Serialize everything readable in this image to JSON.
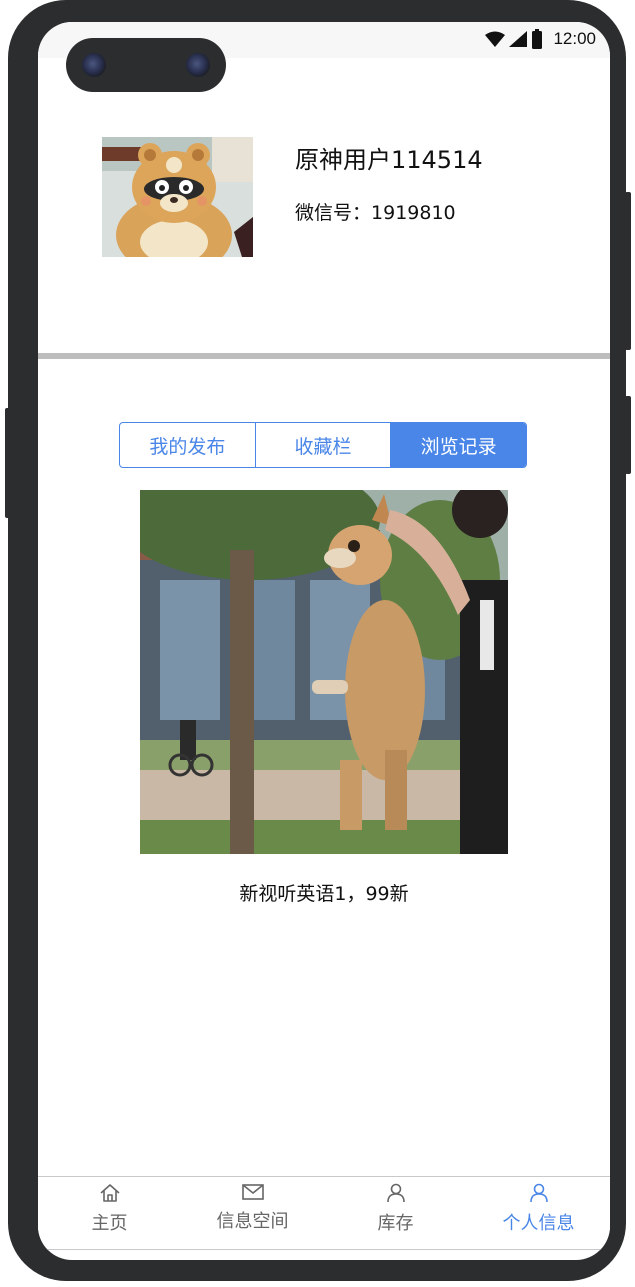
{
  "status_bar": {
    "time": "12:00"
  },
  "profile": {
    "username": "原神用户114514",
    "wechat_label": "微信号：",
    "wechat_id": "1919810"
  },
  "tabs": [
    {
      "label": "我的发布",
      "active": false
    },
    {
      "label": "收藏栏",
      "active": false
    },
    {
      "label": "浏览记录",
      "active": true
    }
  ],
  "post": {
    "title": "新视听英语1，99新"
  },
  "bottom_nav": [
    {
      "label": "主页",
      "icon": "home-icon",
      "active": false
    },
    {
      "label": "信息空间",
      "icon": "mail-icon",
      "active": false
    },
    {
      "label": "库存",
      "icon": "person-icon",
      "active": false
    },
    {
      "label": "个人信息",
      "icon": "person-icon",
      "active": true
    }
  ],
  "colors": {
    "accent": "#4a86e8",
    "nav_text": "#666666",
    "divider": "#bdbdbd"
  }
}
